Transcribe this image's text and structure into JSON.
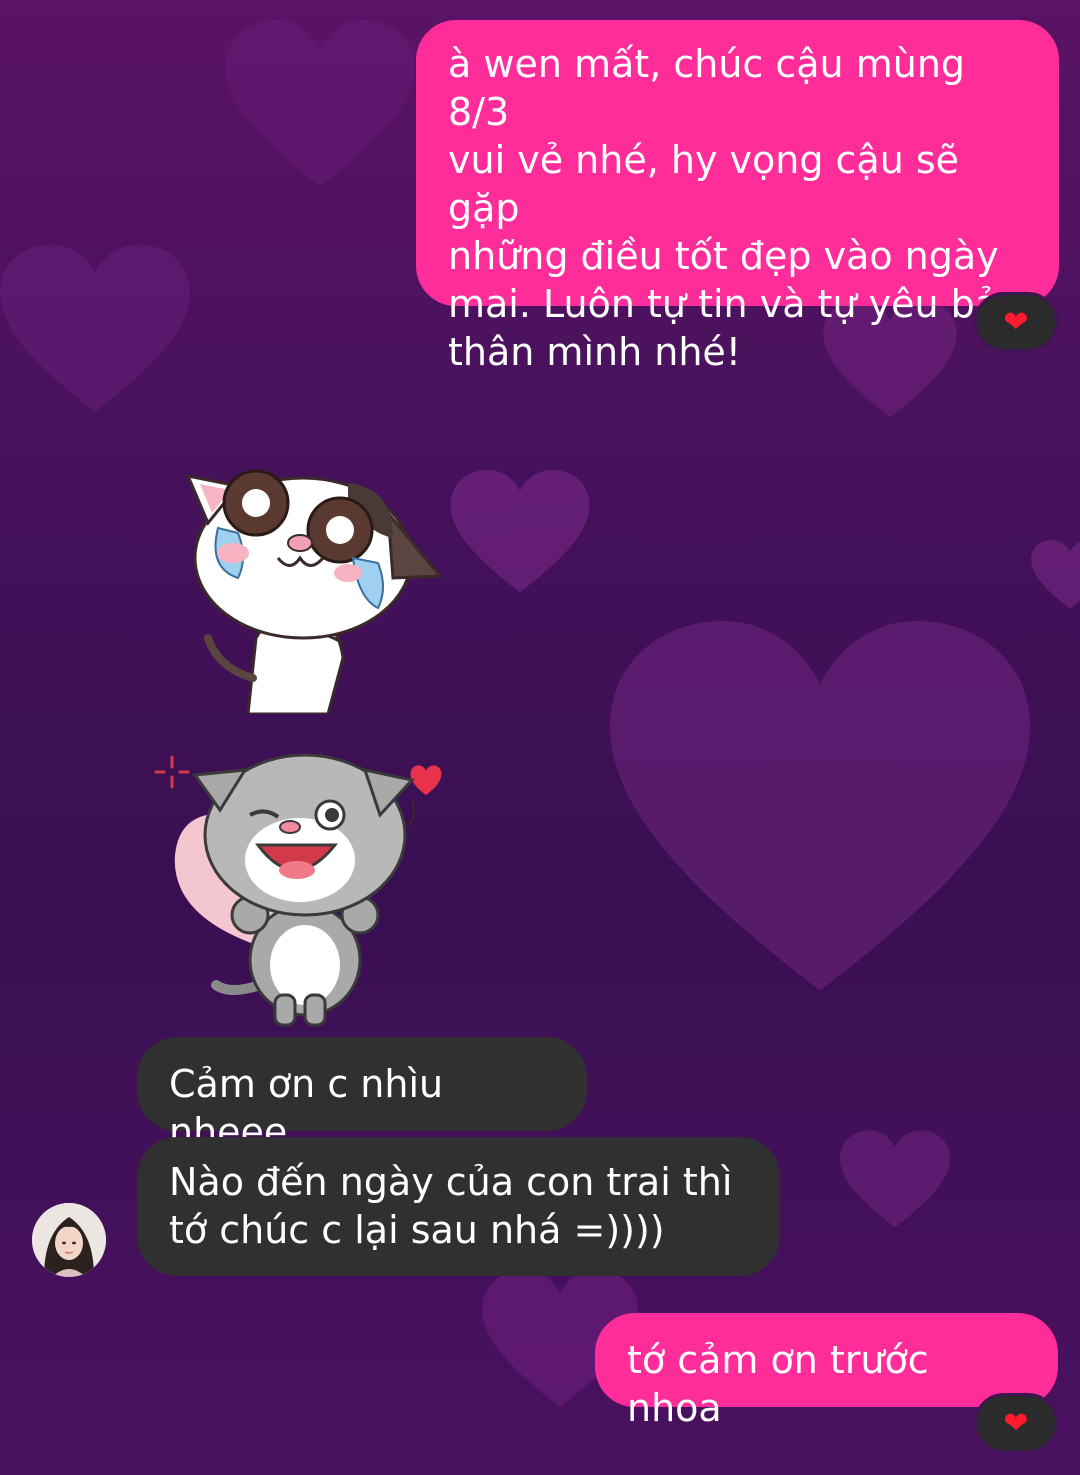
{
  "conversation": {
    "messages": [
      {
        "sender": "me",
        "text": "à wen mất, chúc cậu mùng 8/3\nvui vẻ nhé, hy vọng cậu sẽ gặp\nnhững điều tốt đẹp vào ngày\nmai. Luôn tự tin và tự yêu bản\nthân mình nhé!",
        "reaction": "❤"
      },
      {
        "sender": "them",
        "type": "sticker",
        "sticker": "crying-happy-cat-sticker"
      },
      {
        "sender": "them",
        "type": "sticker",
        "sticker": "winking-gray-cat-sticker"
      },
      {
        "sender": "them",
        "text": "Cảm ơn c nhìu nheee"
      },
      {
        "sender": "them",
        "text": "Nào đến ngày của con trai thì\ntớ chúc c lại sau nhá =))))"
      },
      {
        "sender": "me",
        "text": "tớ cảm ơn trước nhoa",
        "reaction": "❤"
      }
    ]
  },
  "theme": {
    "outgoing_bubble": "#ff2d9a",
    "incoming_bubble": "#303030",
    "background": "#44115a",
    "reaction_heart": "#ff1a2e"
  },
  "icons": {
    "reaction": "heart-icon",
    "avatar": "contact-avatar"
  }
}
